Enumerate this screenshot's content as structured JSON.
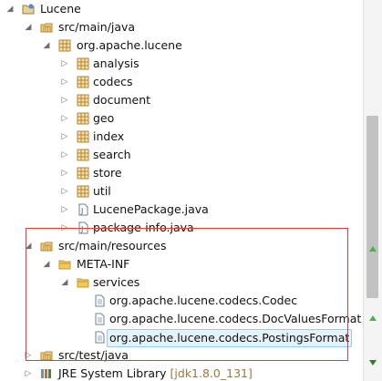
{
  "tree": {
    "project": "Lucene",
    "src_main_java": "src/main/java",
    "package_root": "org.apache.lucene",
    "subpackages": [
      "analysis",
      "codecs",
      "document",
      "geo",
      "index",
      "search",
      "store",
      "util"
    ],
    "java_files": [
      "LucenePackage.java",
      "package-info.java"
    ],
    "src_main_resources": "src/main/resources",
    "meta_inf": "META-INF",
    "services": "services",
    "service_files": [
      "org.apache.lucene.codecs.Codec",
      "org.apache.lucene.codecs.DocValuesFormat",
      "org.apache.lucene.codecs.PostingsFormat"
    ],
    "src_test_java": "src/test/java",
    "jre_library": "JRE System Library",
    "jre_version": "[jdk1.8.0_131]"
  },
  "colors": {
    "selection_bg": "#e5f1fb",
    "selection_border": "#99c9ef",
    "highlight_box": "#e23b3b",
    "package_icon": "#b5813b",
    "folder_icon": "#e8b84a"
  }
}
